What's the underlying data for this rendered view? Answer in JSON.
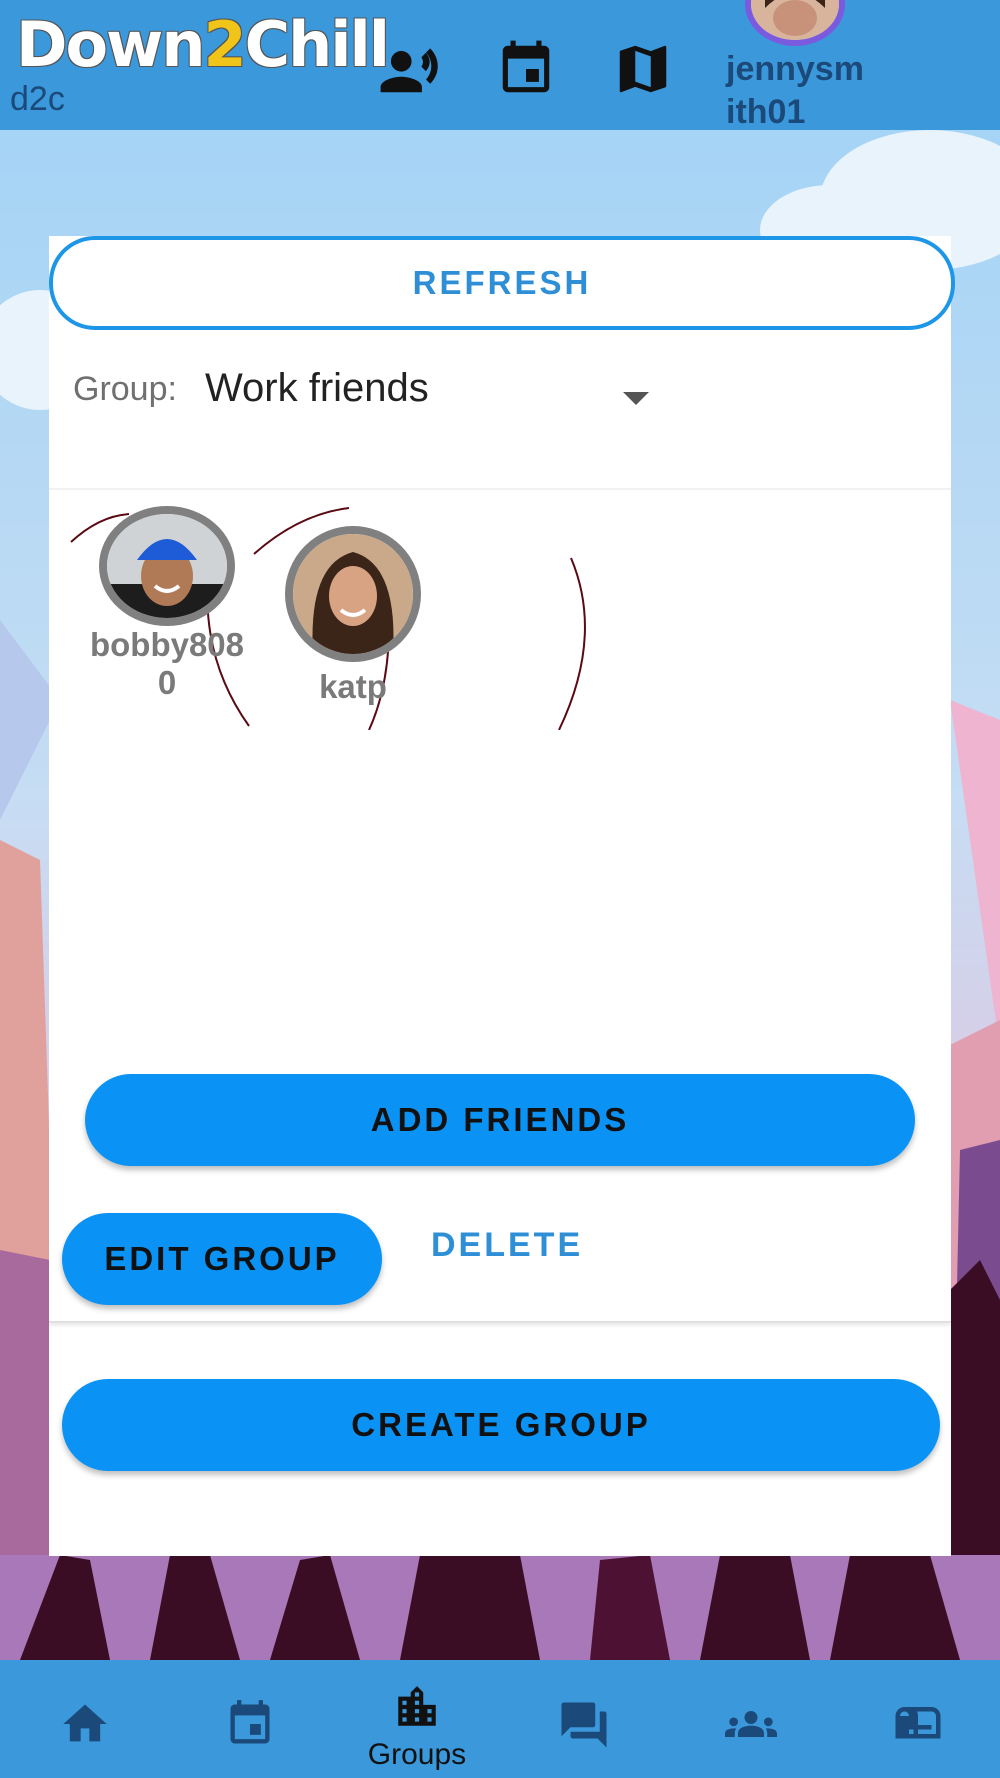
{
  "header": {
    "logo_part1": "Down",
    "logo_part2": "2",
    "logo_part3": "Chill",
    "logo_sub": "d2c",
    "username": "jennysmith01",
    "icons": [
      "broadcast-icon",
      "calendar-icon",
      "map-icon"
    ]
  },
  "card": {
    "refresh_label": "REFRESH",
    "group_label": "Group:",
    "group_value": "Work friends",
    "members": [
      {
        "name": "bobby8080",
        "avatar": "man-blue-beanie"
      },
      {
        "name": "katp",
        "avatar": "woman-curly-hair"
      }
    ],
    "add_friends_label": "ADD FRIENDS",
    "edit_group_label": "EDIT GROUP",
    "delete_label": "DELETE",
    "create_group_label": "CREATE GROUP"
  },
  "bottom_nav": {
    "items": [
      {
        "icon": "home-icon",
        "label": ""
      },
      {
        "icon": "calendar-icon",
        "label": ""
      },
      {
        "icon": "city-icon",
        "label": "Groups",
        "active": true
      },
      {
        "icon": "chat-icon",
        "label": ""
      },
      {
        "icon": "people-icon",
        "label": ""
      },
      {
        "icon": "mailbox-icon",
        "label": ""
      }
    ]
  },
  "colors": {
    "bar": "#3a98db",
    "primary_button": "#0a93f5",
    "accent_text": "#2f8fd6"
  }
}
